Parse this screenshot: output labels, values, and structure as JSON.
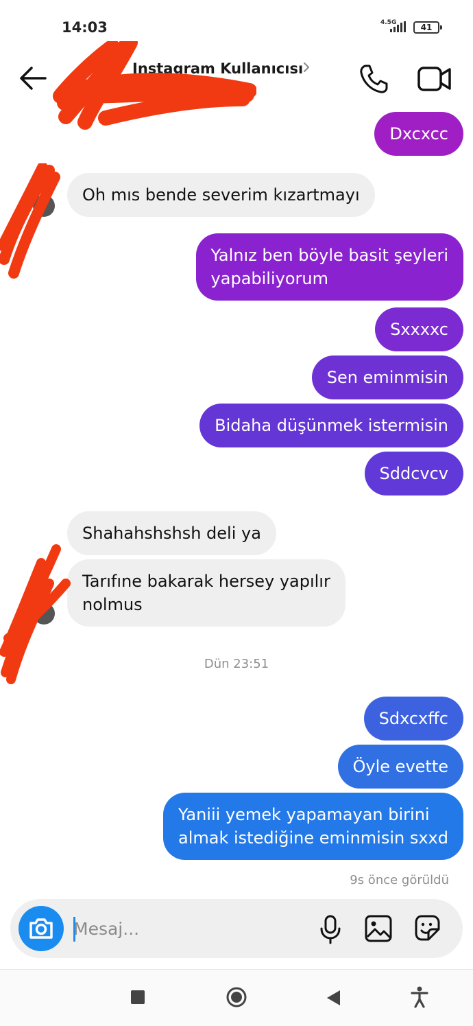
{
  "status_bar": {
    "time": "14:03",
    "network": "4.5G",
    "battery": "41"
  },
  "header": {
    "title": "Instagram Kullanıcısı"
  },
  "messages": [
    {
      "side": "out",
      "text": "Dxcxcc"
    },
    {
      "side": "in",
      "text": "Oh mıs bende severim kızartmayı"
    },
    {
      "side": "out",
      "text": "Yalnız ben böyle basit şeyleri\nyapabiliyorum"
    },
    {
      "side": "out",
      "text": "Sxxxxc"
    },
    {
      "side": "out",
      "text": "Sen eminmisin"
    },
    {
      "side": "out",
      "text": "Bidaha düşünmek istermisin"
    },
    {
      "side": "out",
      "text": "Sddcvcv"
    },
    {
      "side": "in",
      "text": "Shahahshshsh deli ya"
    },
    {
      "side": "in",
      "text": "Tarıfıne bakarak hersey yapılır\nnolmus"
    },
    {
      "side": "out",
      "text": "Sdxcxffc"
    },
    {
      "side": "out",
      "text": "Öyle evette"
    },
    {
      "side": "out",
      "text": "Yaniii yemek yapamayan birini\nalmak istediğine eminmisin sxxd"
    }
  ],
  "timestamp_divider": "Dün 23:51",
  "seen_status": "9s önce görüldü",
  "composer": {
    "placeholder": "Mesaj..."
  },
  "icons": {
    "back": "arrow-left-icon",
    "phone": "phone-icon",
    "video": "video-camera-icon",
    "camera": "camera-icon",
    "mic": "microphone-icon",
    "gallery": "image-gallery-icon",
    "sticker": "sticker-icon"
  },
  "colors": {
    "incoming_bubble": "#efefef",
    "accent_blue": "#1a8cf0",
    "redaction": "#f23a12"
  }
}
